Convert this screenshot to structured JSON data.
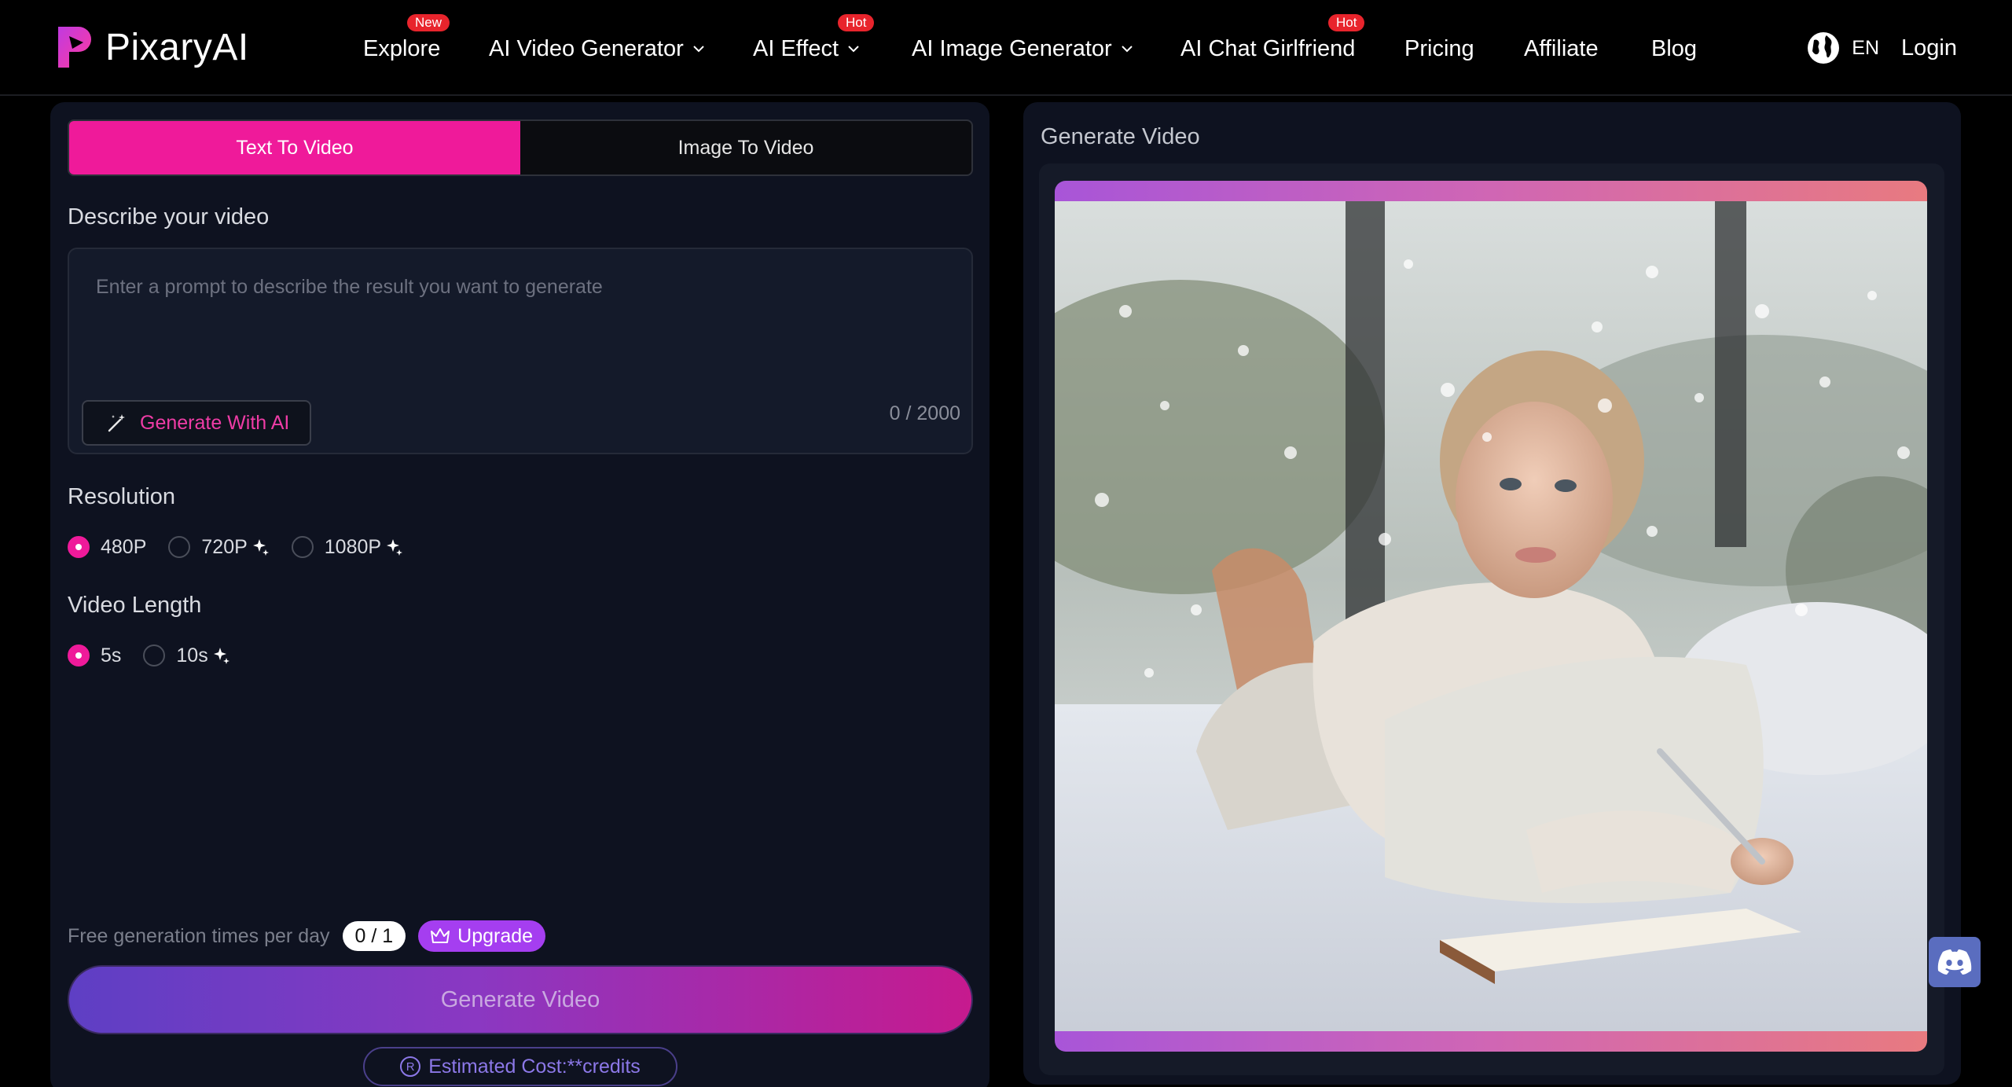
{
  "brand": {
    "name": "PixaryAI"
  },
  "nav": {
    "items": [
      {
        "label": "Explore",
        "badge": "New",
        "has_dropdown": false
      },
      {
        "label": "AI Video Generator",
        "badge": "",
        "has_dropdown": true
      },
      {
        "label": "AI Effect",
        "badge": "Hot",
        "has_dropdown": true
      },
      {
        "label": "AI Image Generator",
        "badge": "",
        "has_dropdown": true
      },
      {
        "label": "AI Chat Girlfriend",
        "badge": "Hot",
        "has_dropdown": false
      },
      {
        "label": "Pricing",
        "badge": "",
        "has_dropdown": false
      },
      {
        "label": "Affiliate",
        "badge": "",
        "has_dropdown": false
      },
      {
        "label": "Blog",
        "badge": "",
        "has_dropdown": false
      }
    ],
    "language": "EN",
    "login": "Login"
  },
  "tabs": {
    "text_to_video": "Text To Video",
    "image_to_video": "Image To Video",
    "active": "text_to_video"
  },
  "prompt": {
    "label": "Describe your video",
    "placeholder": "Enter a prompt to describe the result you want to generate",
    "value": "",
    "char_count": "0 / 2000",
    "generate_with_ai": "Generate With AI"
  },
  "resolution": {
    "label": "Resolution",
    "options": [
      {
        "label": "480P",
        "selected": true,
        "premium": false
      },
      {
        "label": "720P",
        "selected": false,
        "premium": true
      },
      {
        "label": "1080P",
        "selected": false,
        "premium": true
      }
    ]
  },
  "video_length": {
    "label": "Video Length",
    "options": [
      {
        "label": "5s",
        "selected": true,
        "premium": false
      },
      {
        "label": "10s",
        "selected": false,
        "premium": true
      }
    ]
  },
  "quota": {
    "label": "Free generation times per day",
    "count": "0 / 1",
    "upgrade": "Upgrade"
  },
  "generate_button": "Generate Video",
  "estimated_cost": "Estimated Cost:**credits",
  "preview": {
    "title": "Generate Video"
  },
  "colors": {
    "accent": "#ef1a9a",
    "upgrade": "#a53ef0",
    "badge": "#e8242c",
    "panel": "#0e1220"
  }
}
